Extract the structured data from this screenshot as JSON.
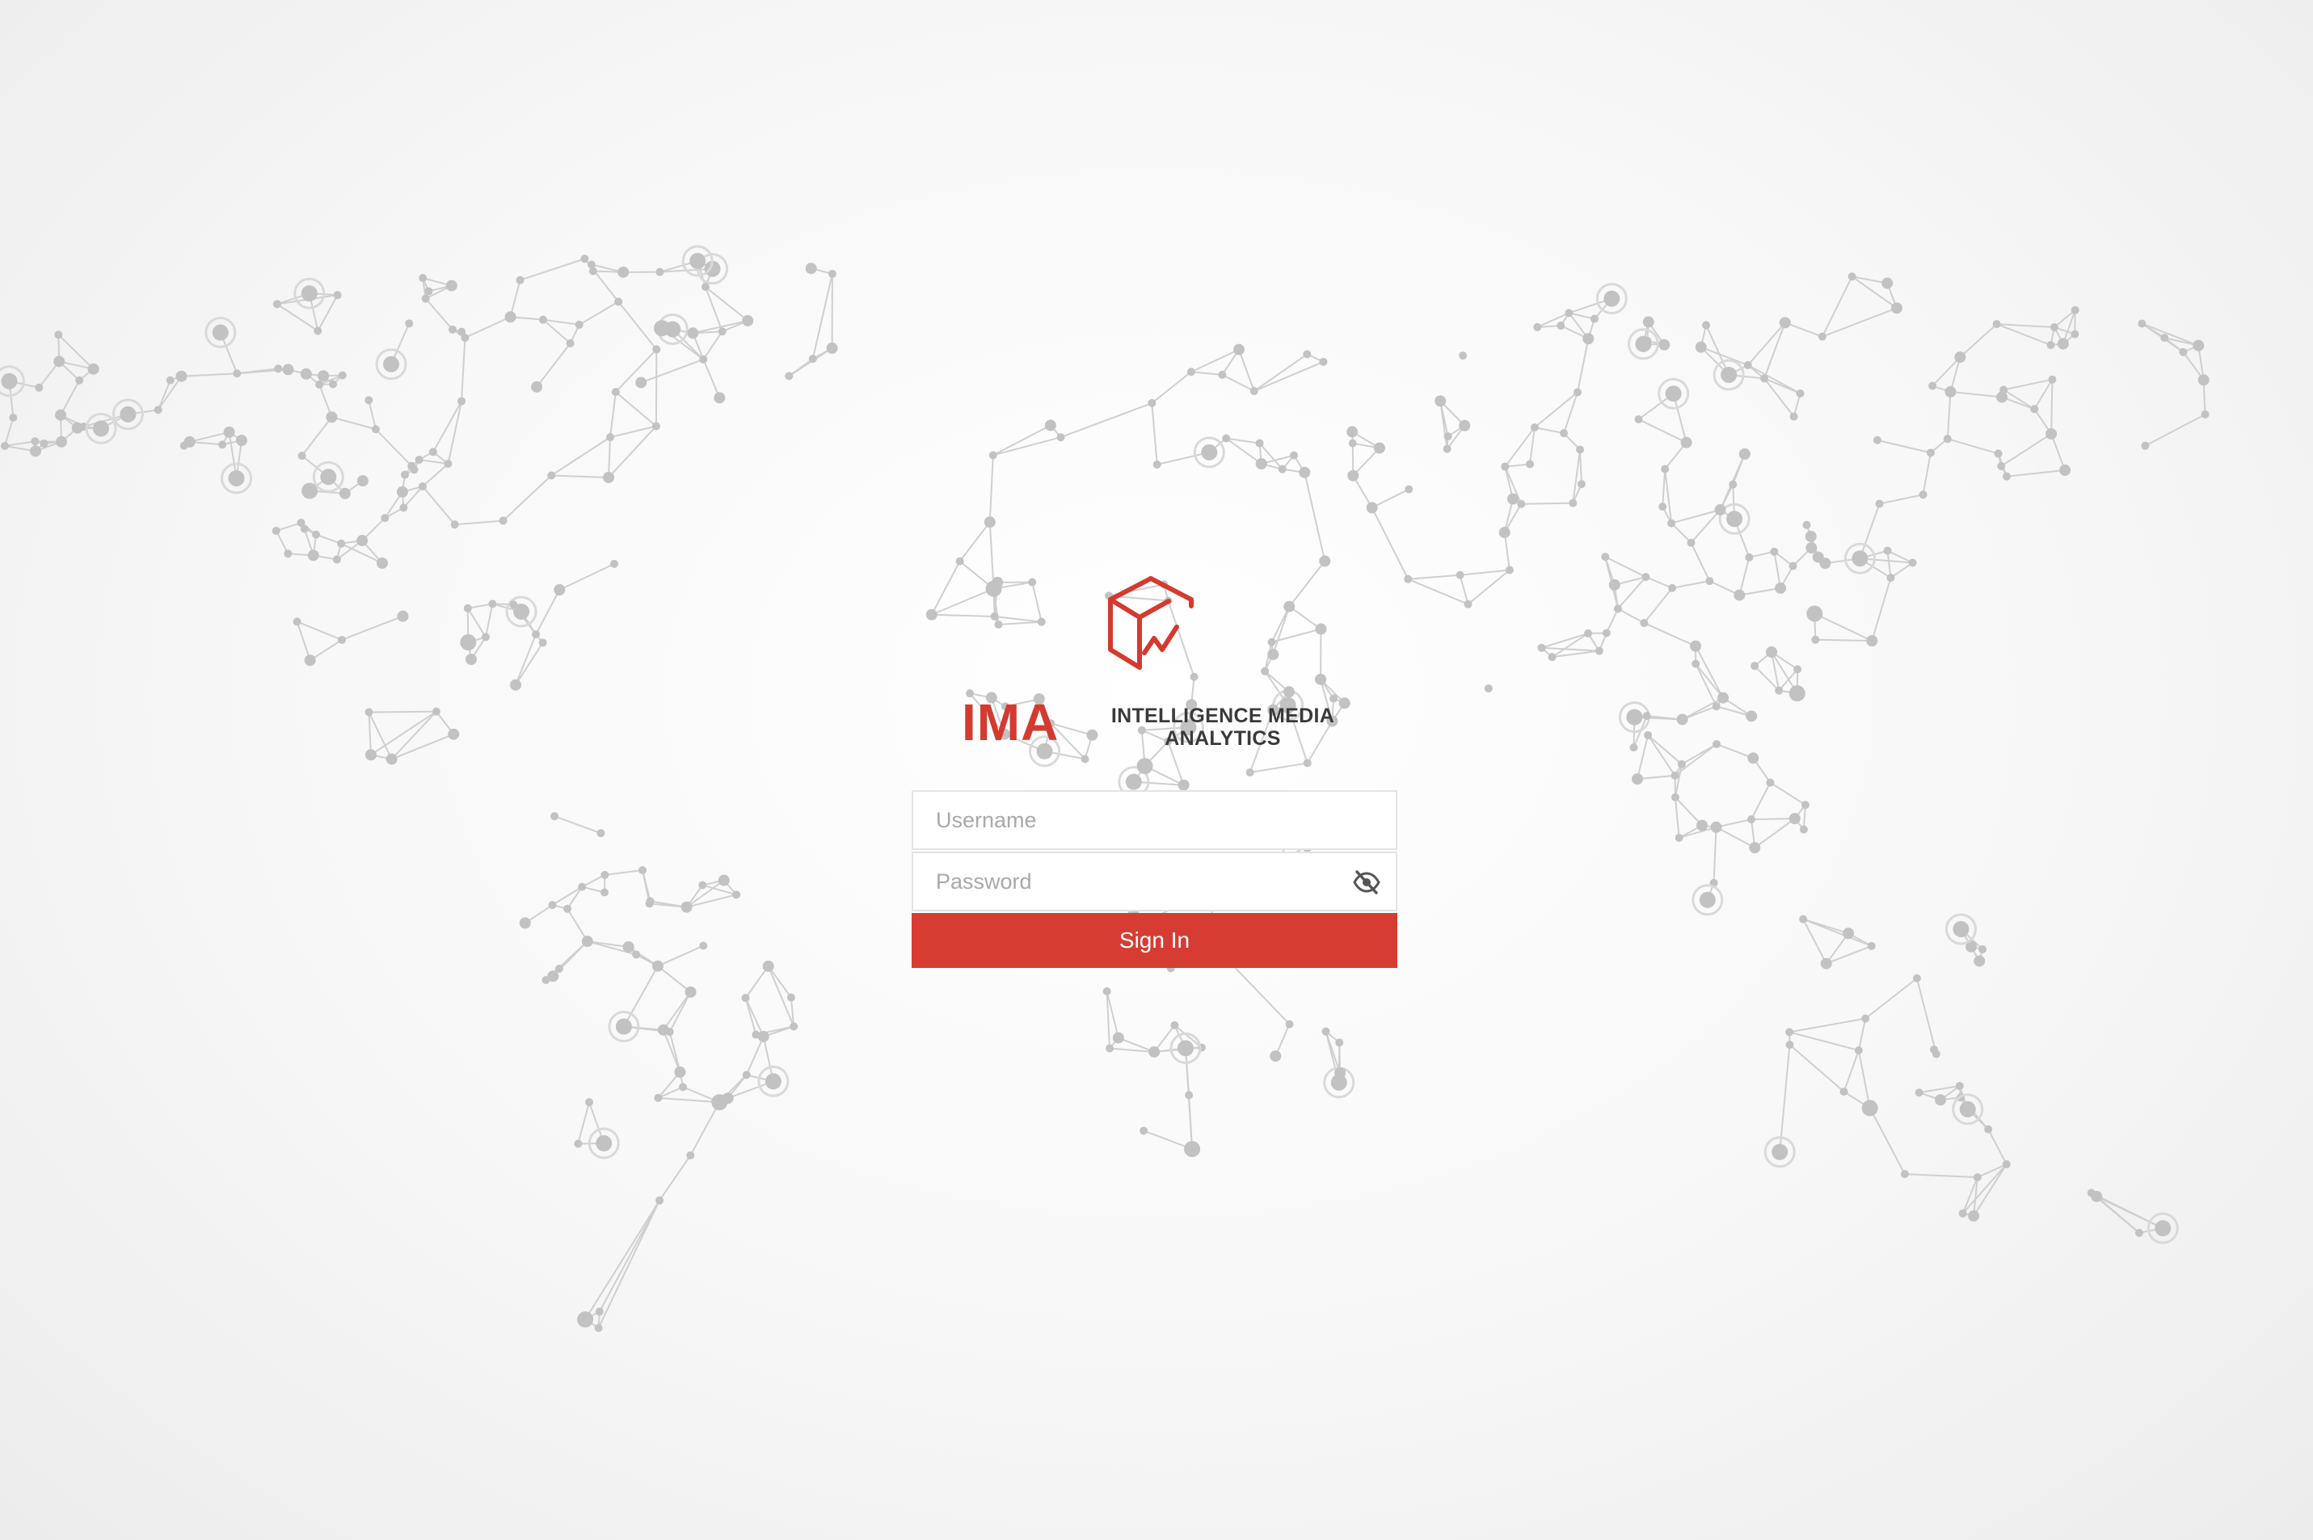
{
  "brand": {
    "abbr": "IMA",
    "name": "INTELLIGENCE MEDIA ANALYTICS",
    "accent_color": "#d43a2f",
    "icon": "cube-chart-logo-icon"
  },
  "login": {
    "username_placeholder": "Username",
    "password_placeholder": "Password",
    "password_toggle_icon": "eye-slash-icon",
    "submit_label": "Sign In",
    "button_color": "#d63c32"
  },
  "background": {
    "style": "network-world-map",
    "line_color": "#cfcfcf",
    "node_color": "#c2c2c2"
  }
}
